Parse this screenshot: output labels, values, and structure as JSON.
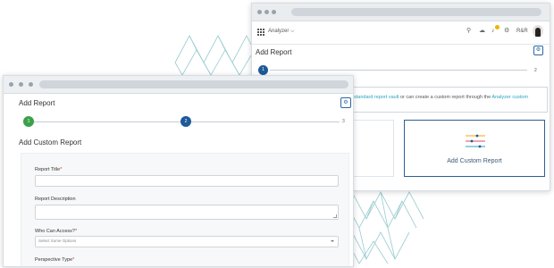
{
  "colors": {
    "primary": "#1d5a99",
    "success": "#3ba04a",
    "accent": "#2ba3c1",
    "required": "#d33333",
    "pattern": "#87c2c8"
  },
  "back_window": {
    "app_name": "Analyzer",
    "user_label": "R&R",
    "page_title": "Add Report",
    "stepper": {
      "step1": "1",
      "step2": "2"
    },
    "info": {
      "link1": "standard report vault",
      "middle": " or can create a custom report through the ",
      "link2": "Analyzer custom"
    },
    "custom_card_label": "Add Custom Report"
  },
  "front_window": {
    "page_title": "Add Report",
    "stepper": {
      "step1": "1",
      "step2": "2",
      "step3": "3"
    },
    "section_title": "Add Custom Report",
    "form": {
      "report_title_label": "Report Title",
      "report_description_label": "Report Description",
      "who_can_access_label": "Who Can Access?",
      "who_can_access_placeholder": "Select Some Options",
      "perspective_type_label": "Perspective Type",
      "required_mark": "*"
    }
  }
}
